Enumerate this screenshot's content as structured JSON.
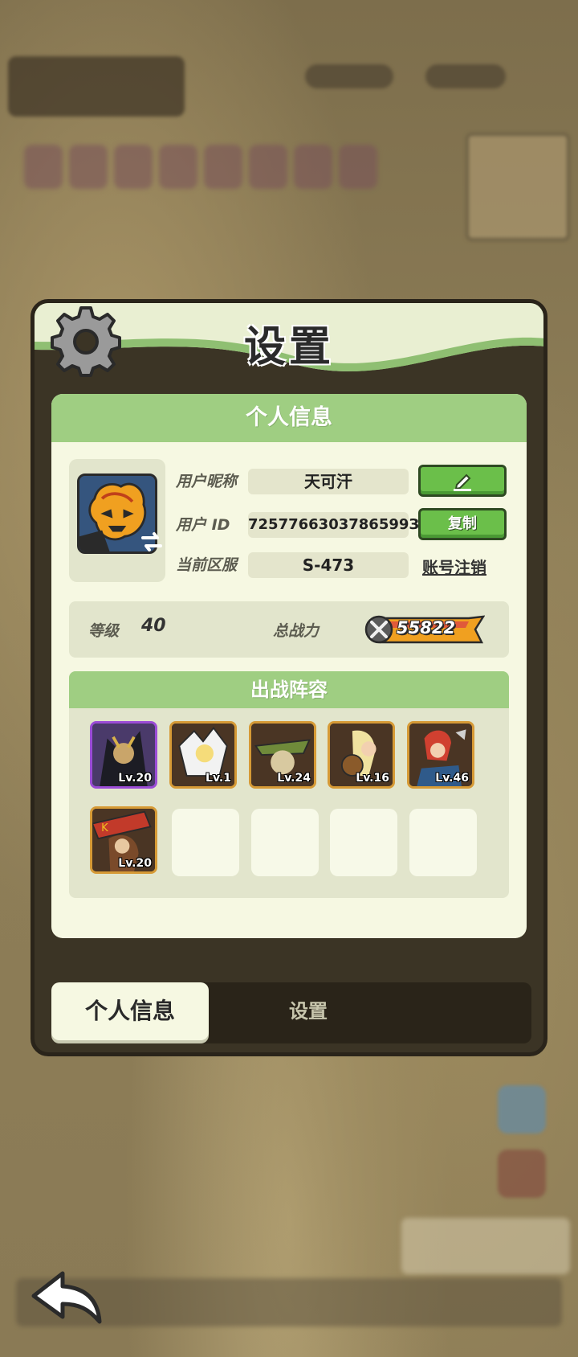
{
  "panel": {
    "title": "设置"
  },
  "profile_card": {
    "header": "个人信息",
    "nickname_label": "用户昵称",
    "nickname_value": "天可汗",
    "id_label": "用户 ID",
    "id_value": "7257766303786599З",
    "server_label": "当前区服",
    "server_value": "S-473",
    "copy_button": "复制",
    "delete_account_link": "账号注销",
    "level_label": "等级",
    "level_value": "40",
    "power_label": "总战力",
    "power_value": "55822"
  },
  "lineup": {
    "header": "出战阵容",
    "heroes": [
      {
        "level": "Lv.20",
        "rarity": "purple"
      },
      {
        "level": "Lv.1",
        "rarity": "gold"
      },
      {
        "level": "Lv.24",
        "rarity": "gold"
      },
      {
        "level": "Lv.16",
        "rarity": "gold"
      },
      {
        "level": "Lv.46",
        "rarity": "gold"
      },
      {
        "level": "Lv.20",
        "rarity": "gold"
      }
    ],
    "empty_slots": 4
  },
  "tabs": [
    {
      "label": "个人信息",
      "active": true
    },
    {
      "label": "设置",
      "active": false
    }
  ],
  "icons": {
    "gear": "gear-icon",
    "edit": "pencil-icon",
    "swap": "swap-icon",
    "power": "crossed-swords-icon",
    "back": "back-arrow-icon"
  },
  "colors": {
    "header_green": "#9fce82",
    "button_green": "#6bbf4a",
    "panel_dark": "#3b3425",
    "card_bg": "#f6f8e2"
  }
}
